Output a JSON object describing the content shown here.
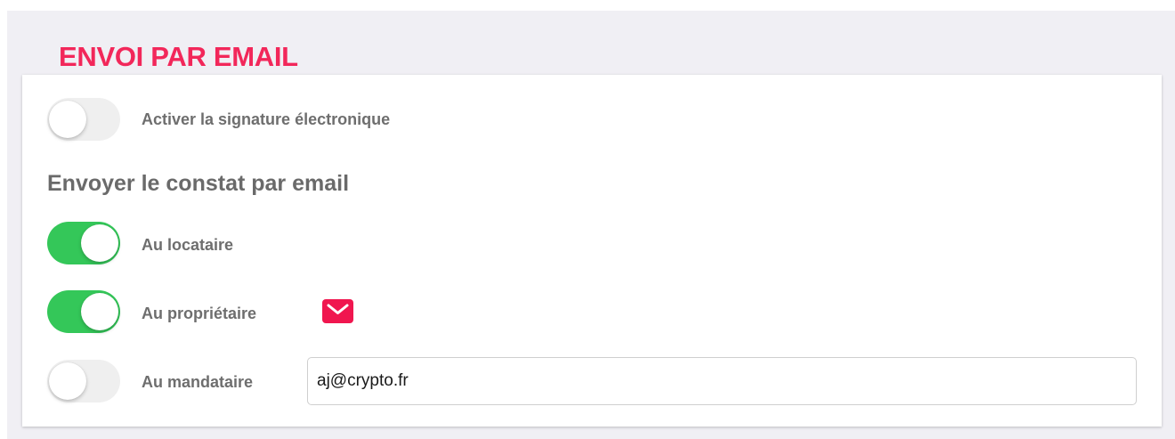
{
  "section": {
    "title": "ENVOI PAR EMAIL"
  },
  "signature": {
    "label": "Activer la signature électronique",
    "enabled": false
  },
  "send_email": {
    "heading": "Envoyer le constat par email",
    "options": [
      {
        "label": "Au locataire",
        "enabled": true
      },
      {
        "label": "Au propriétaire",
        "enabled": true,
        "icon": "mail-icon"
      },
      {
        "label": "Au mandataire",
        "enabled": false,
        "email_value": "aj@crypto.fr"
      }
    ]
  },
  "colors": {
    "accent": "#f2275a",
    "toggle_on": "#34c759",
    "toggle_off": "#efefef",
    "icon_background": "#f0164f"
  }
}
